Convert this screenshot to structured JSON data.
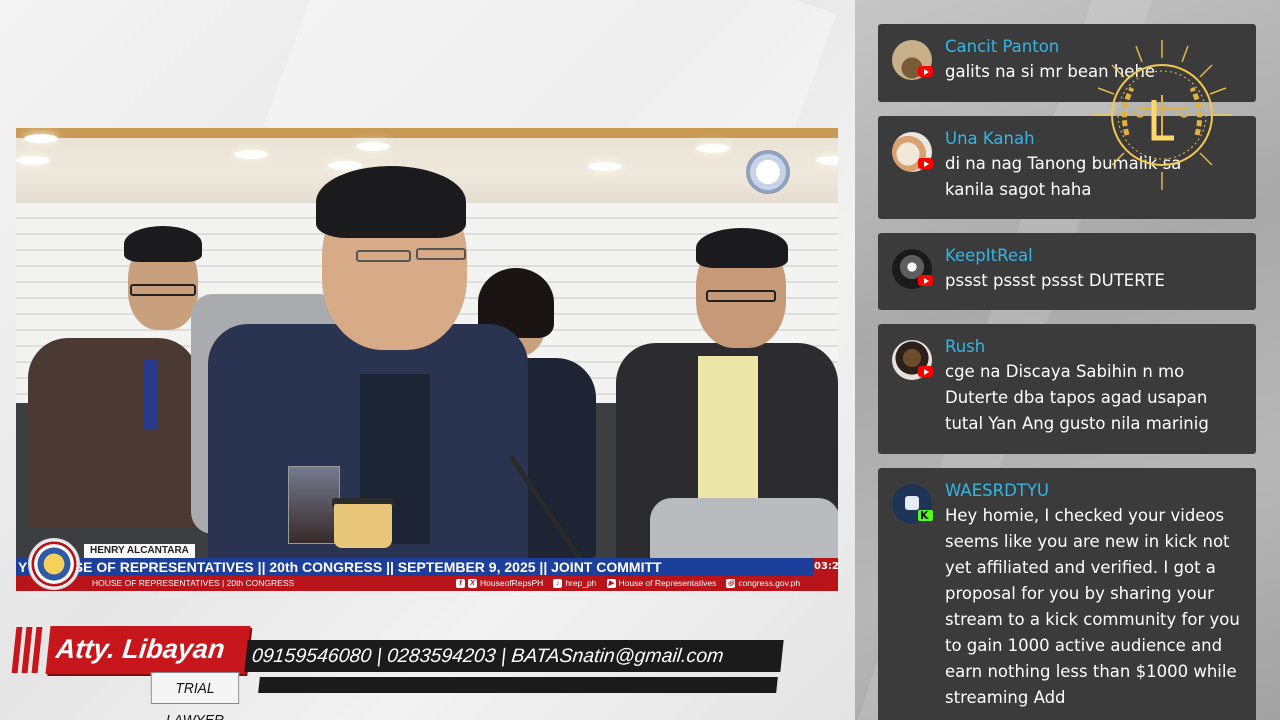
{
  "broadcast": {
    "ticker_headline": "Y || HOUSE OF REPRESENTATIVES || 20th CONGRESS || SEPTEMBER 9, 2025 || JOINT COMMITT",
    "ticker_time": "03:2",
    "ticker_subline": "HOUSE OF REPRESENTATIVES   |   20th CONGRESS",
    "ticker_nameplate": "HENRY ALCANTARA",
    "ticker_links": [
      "HouseofRepsPH",
      "hrep_ph",
      "House of Representatives",
      "congress.gov.ph"
    ]
  },
  "lower_third": {
    "name": "Atty. Libayan",
    "title": "TRIAL LAWYER",
    "contact": "09159546080 | 0283594203 | BATASnatin@gmail.com"
  },
  "chat": {
    "messages": [
      {
        "user": "Cancit Panton",
        "text": "galits na si mr bean hehe",
        "platform": "youtube"
      },
      {
        "user": "Una Kanah",
        "text": "di na nag Tanong bumalik sa kanila sagot haha",
        "platform": "youtube"
      },
      {
        "user": "KeepItReal",
        "text": "pssst pssst pssst DUTERTE",
        "platform": "youtube"
      },
      {
        "user": "Rush",
        "text": "cge na Discaya Sabihin n mo Duterte dba tapos agad usapan tutal Yan Ang gusto nila marinig",
        "platform": "youtube"
      },
      {
        "user": "WAESRDTYU",
        "text": "Hey homie, I checked your videos seems like you are new in kick not yet affiliated and verified. I got a proposal for you by sharing your stream to a kick community for you to gain 1000 active audience and earn nothing less than $1000 while streaming Add",
        "platform": "kick"
      }
    ]
  },
  "colors": {
    "ticker_blue": "#1c3f9b",
    "ticker_red": "#b8141a",
    "name_red": "#c8161d",
    "chat_bubble": "#3b3b3b",
    "chat_username": "#33b6e6",
    "youtube_red": "#ff0000",
    "kick_green": "#53fc18"
  }
}
